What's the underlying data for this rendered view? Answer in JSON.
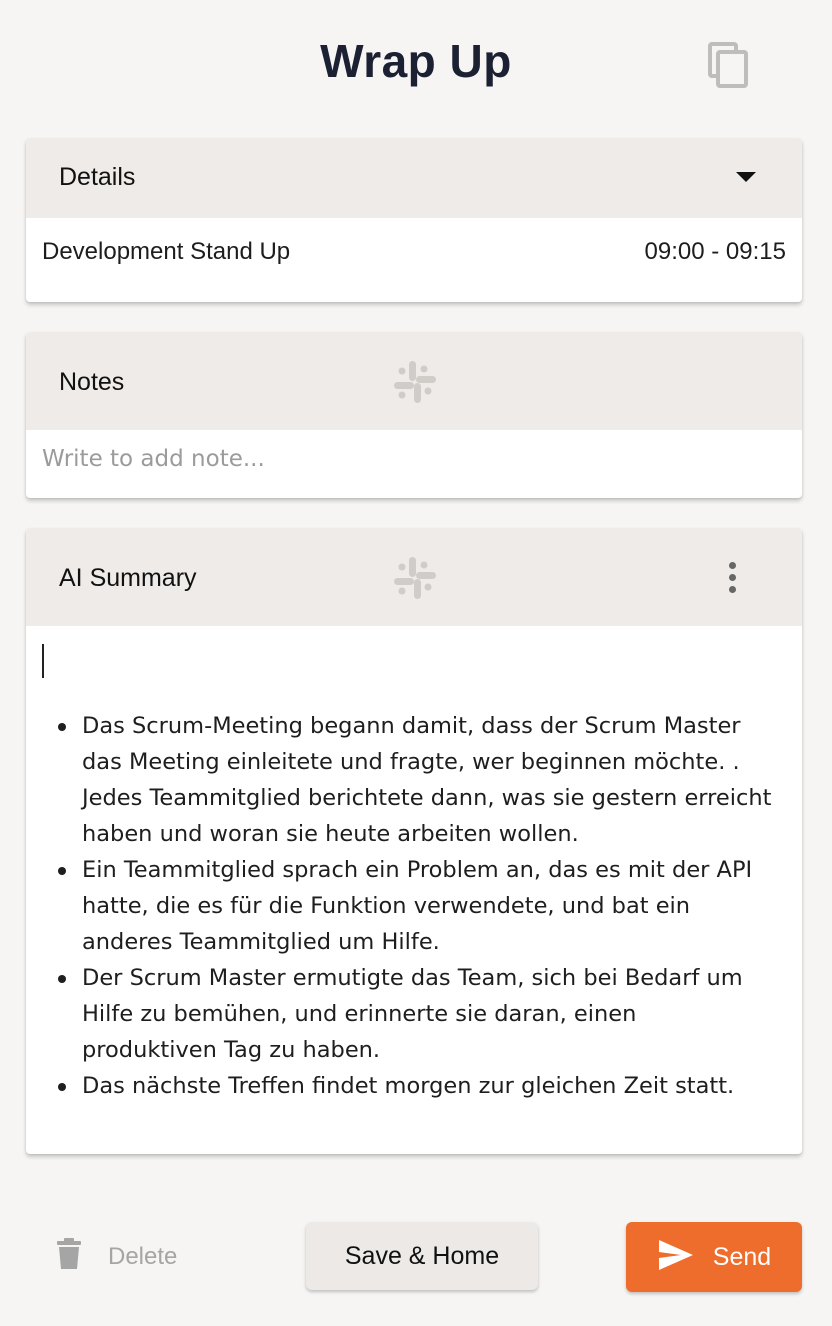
{
  "header": {
    "title": "Wrap Up",
    "copy_icon": "copy-icon"
  },
  "details": {
    "title": "Details",
    "toggle_icon": "caret-down-icon",
    "meeting_name": "Development Stand Up",
    "meeting_time": "09:00 - 09:15"
  },
  "notes": {
    "title": "Notes",
    "icon": "slack-icon",
    "placeholder": "Write to add note...",
    "value": ""
  },
  "summary": {
    "title": "AI Summary",
    "icon": "slack-icon",
    "menu_icon": "more-vertical-icon",
    "items": [
      "Das Scrum-Meeting begann damit, dass der Scrum Master das Meeting einleitete und fragte, wer beginnen möchte. . Jedes Teammitglied berichtete dann, was sie gestern erreicht haben und woran sie heute arbeiten wollen.",
      "Ein Teammitglied sprach ein Problem an, das es mit der API hatte, die es für die Funktion verwendete, und bat ein anderes Teammitglied um Hilfe.",
      "Der Scrum Master ermutigte das Team, sich bei Bedarf um Hilfe zu bemühen, und erinnerte sie daran, einen produktiven Tag zu haben.",
      "Das nächste Treffen findet morgen zur gleichen Zeit statt."
    ]
  },
  "footer": {
    "delete_label": "Delete",
    "delete_icon": "trash-icon",
    "save_label": "Save & Home",
    "send_label": "Send",
    "send_icon": "send-icon"
  },
  "colors": {
    "background": "#f6f5f3",
    "card_header": "#eeebe8",
    "title": "#1c2033",
    "send_button": "#ee6c2c",
    "save_button": "#ece9e6"
  }
}
